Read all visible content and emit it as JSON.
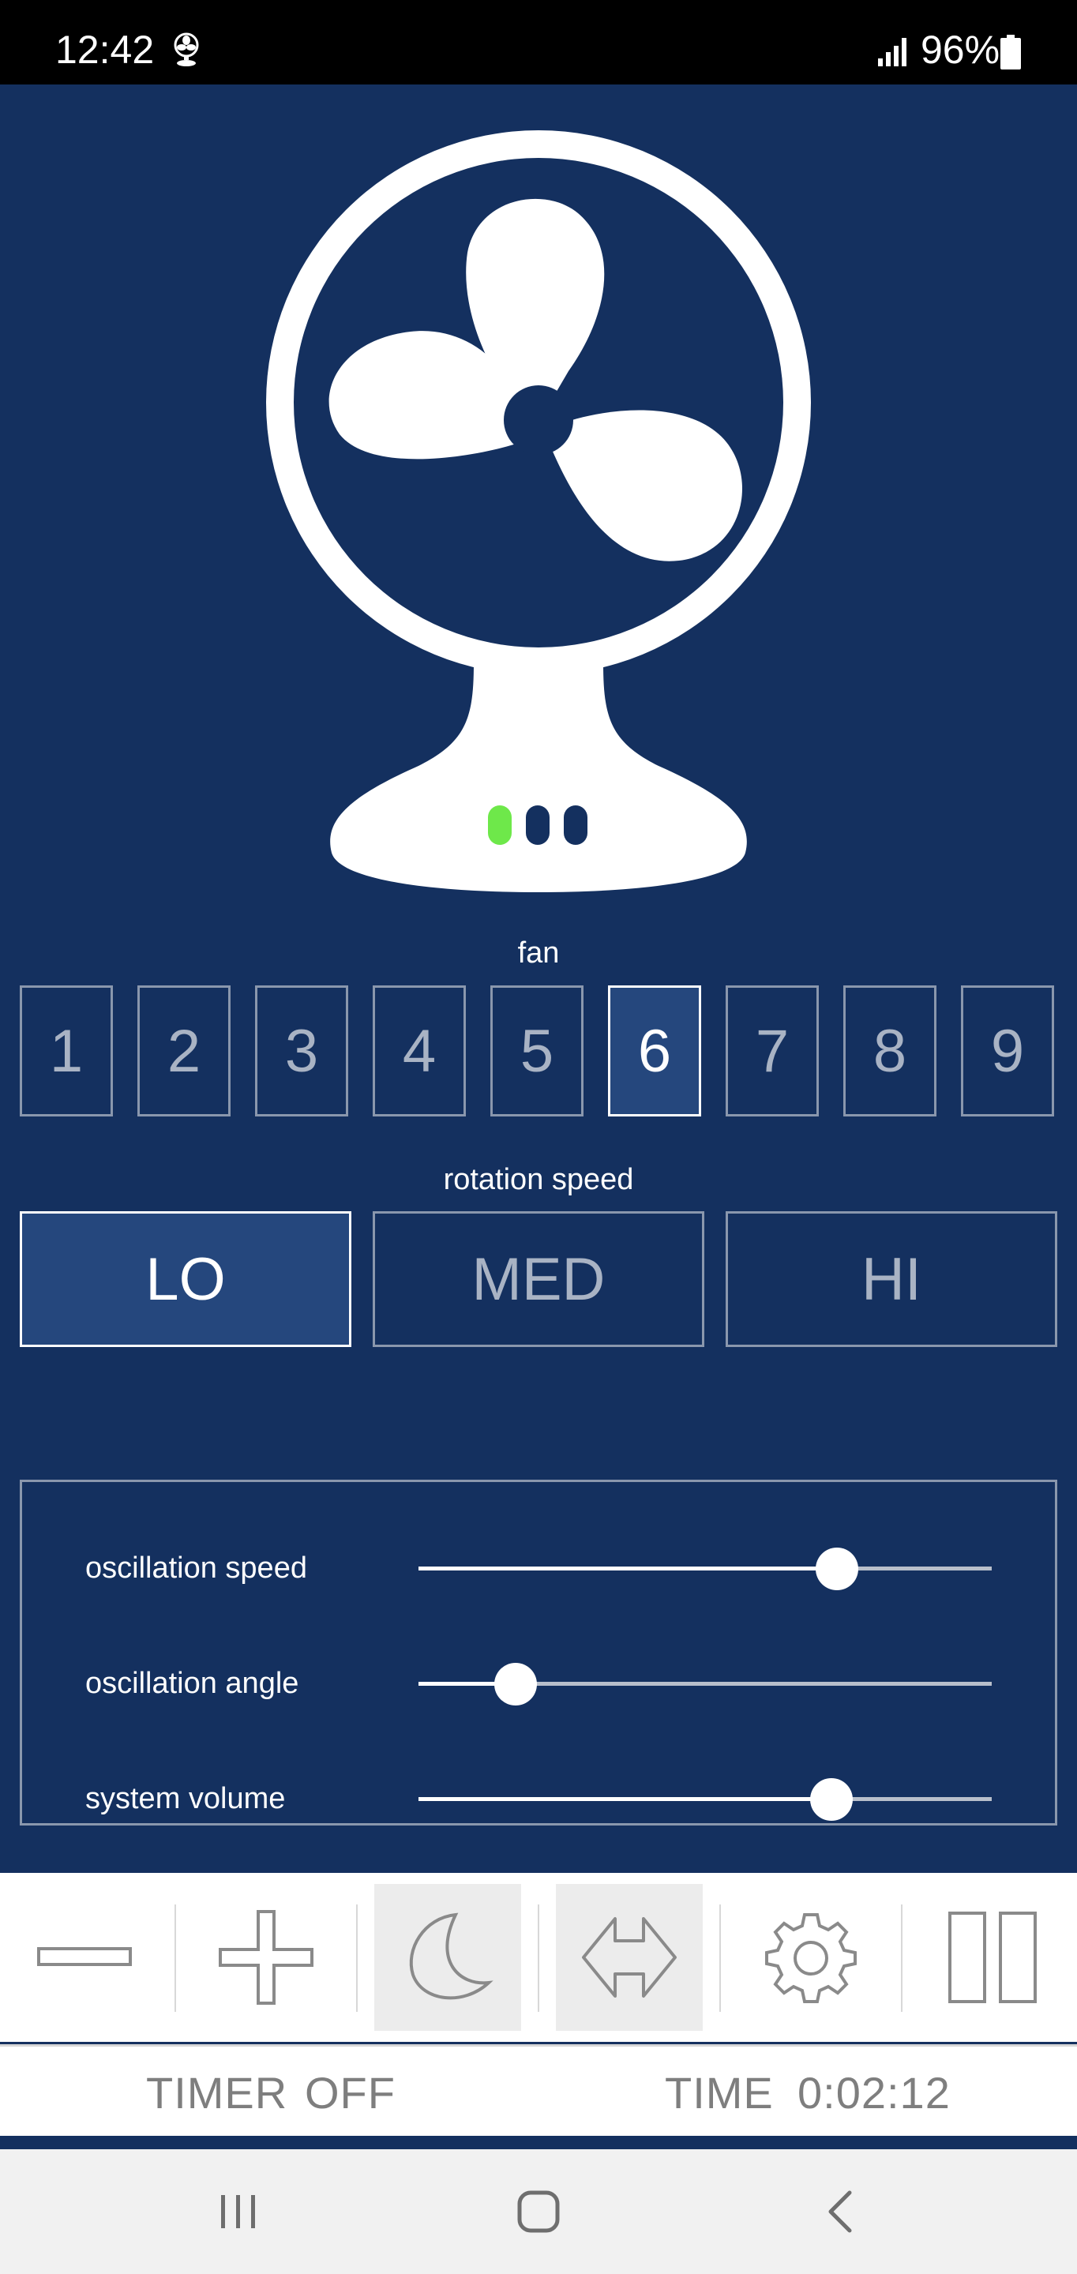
{
  "status_bar": {
    "time": "12:42",
    "battery_percent": "96%"
  },
  "fan_section": {
    "label": "fan",
    "levels": [
      "1",
      "2",
      "3",
      "4",
      "5",
      "6",
      "7",
      "8",
      "9"
    ],
    "selected": "6"
  },
  "rotation_section": {
    "label": "rotation speed",
    "options": [
      "LO",
      "MED",
      "HI"
    ],
    "selected": "LO"
  },
  "sliders": [
    {
      "label": "oscillation speed",
      "value_percent": 73
    },
    {
      "label": "oscillation angle",
      "value_percent": 17
    },
    {
      "label": "system volume",
      "value_percent": 72
    }
  ],
  "toolbar": {
    "icons": [
      "minus-icon",
      "plus-icon",
      "moon-icon",
      "arrows-horizontal-icon",
      "gear-icon",
      "pause-icon"
    ],
    "selected": [
      "moon-icon",
      "arrows-horizontal-icon"
    ]
  },
  "timer": {
    "timer_label": "TIMER",
    "timer_value": "OFF",
    "time_label": "TIME",
    "time_value": "0:02:12"
  },
  "colors": {
    "background": "#14305f",
    "active_button": "#25477d",
    "indicator_green": "#6ee84a"
  }
}
